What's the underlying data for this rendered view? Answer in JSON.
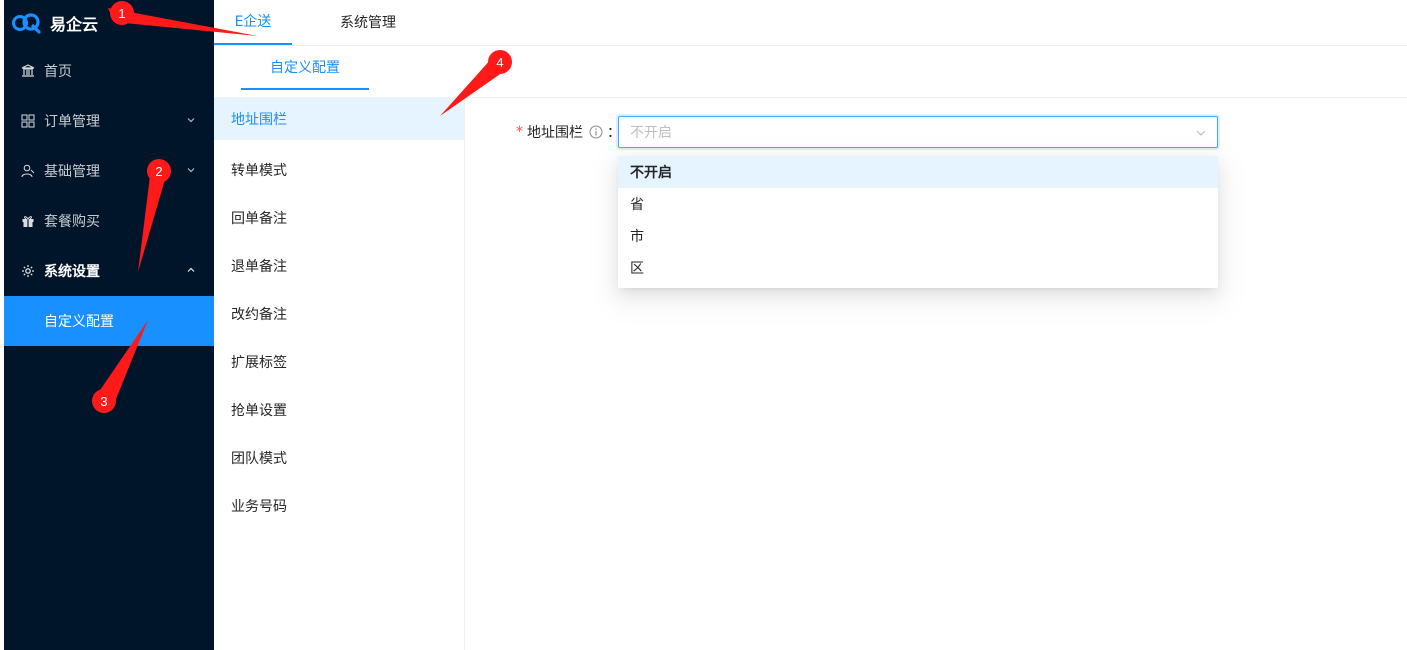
{
  "app": {
    "title": "易企云"
  },
  "sidebar": {
    "items": [
      {
        "label": "首页",
        "icon": "bank-icon"
      },
      {
        "label": "订单管理",
        "icon": "grid-icon"
      },
      {
        "label": "基础管理",
        "icon": "users-icon"
      },
      {
        "label": "套餐购买",
        "icon": "gift-icon"
      },
      {
        "label": "系统设置",
        "icon": "gear-icon"
      }
    ],
    "submenu": [
      {
        "label": "自定义配置"
      }
    ]
  },
  "top_tabs": [
    {
      "label": "E企送"
    },
    {
      "label": "系统管理"
    }
  ],
  "sub_tabs": [
    {
      "label": "自定义配置"
    }
  ],
  "settings_list": [
    {
      "label": "地址围栏"
    },
    {
      "label": "转单模式"
    },
    {
      "label": "回单备注"
    },
    {
      "label": "退单备注"
    },
    {
      "label": "改约备注"
    },
    {
      "label": "扩展标签"
    },
    {
      "label": "抢单设置"
    },
    {
      "label": "团队模式"
    },
    {
      "label": "业务号码"
    }
  ],
  "form": {
    "field_label": "地址围栏",
    "required_mark": "*",
    "colon": "：",
    "select_value": "不开启",
    "options": [
      {
        "label": "不开启"
      },
      {
        "label": "省"
      },
      {
        "label": "市"
      },
      {
        "label": "区"
      }
    ]
  },
  "annotations": [
    {
      "label": "1"
    },
    {
      "label": "2"
    },
    {
      "label": "3"
    },
    {
      "label": "4"
    }
  ],
  "colors": {
    "sidebar_bg": "#001529",
    "accent": "#1890ff",
    "active_bg": "#e6f4ff",
    "annotation": "#ff1a1a"
  }
}
